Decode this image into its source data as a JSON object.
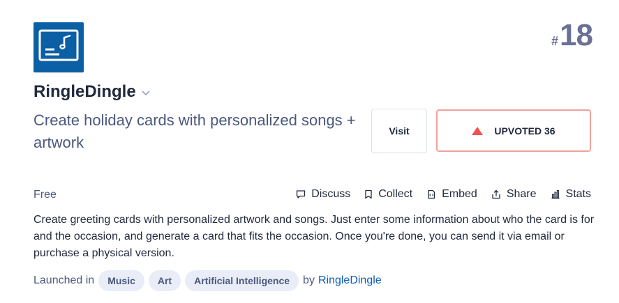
{
  "product": {
    "logo_icon": "music-card-icon",
    "rank_hash": "#",
    "rank_number": "18",
    "name": "RingleDingle",
    "tagline": "Create holiday cards with personalized songs + artwork",
    "price": "Free",
    "description": "Create greeting cards with personalized artwork and songs. Just enter some information about who the card is for and the occasion, and generate a card that fits the occasion. Once you're done, you can send it via email or purchase a physical version."
  },
  "buttons": {
    "visit": "Visit",
    "upvote": "UPVOTED 36"
  },
  "actions": {
    "discuss": "Discuss",
    "collect": "Collect",
    "embed": "Embed",
    "share": "Share",
    "stats": "Stats"
  },
  "launched": {
    "prefix": "Launched in",
    "topics": [
      "Music",
      "Art",
      "Artificial Intelligence"
    ],
    "by": "by",
    "maker": "RingleDingle"
  },
  "colors": {
    "logo_bg": "#0b5fa5",
    "upvote_accent": "#ef5350",
    "link": "#0d5db8",
    "chip_bg": "#e8edf7"
  }
}
